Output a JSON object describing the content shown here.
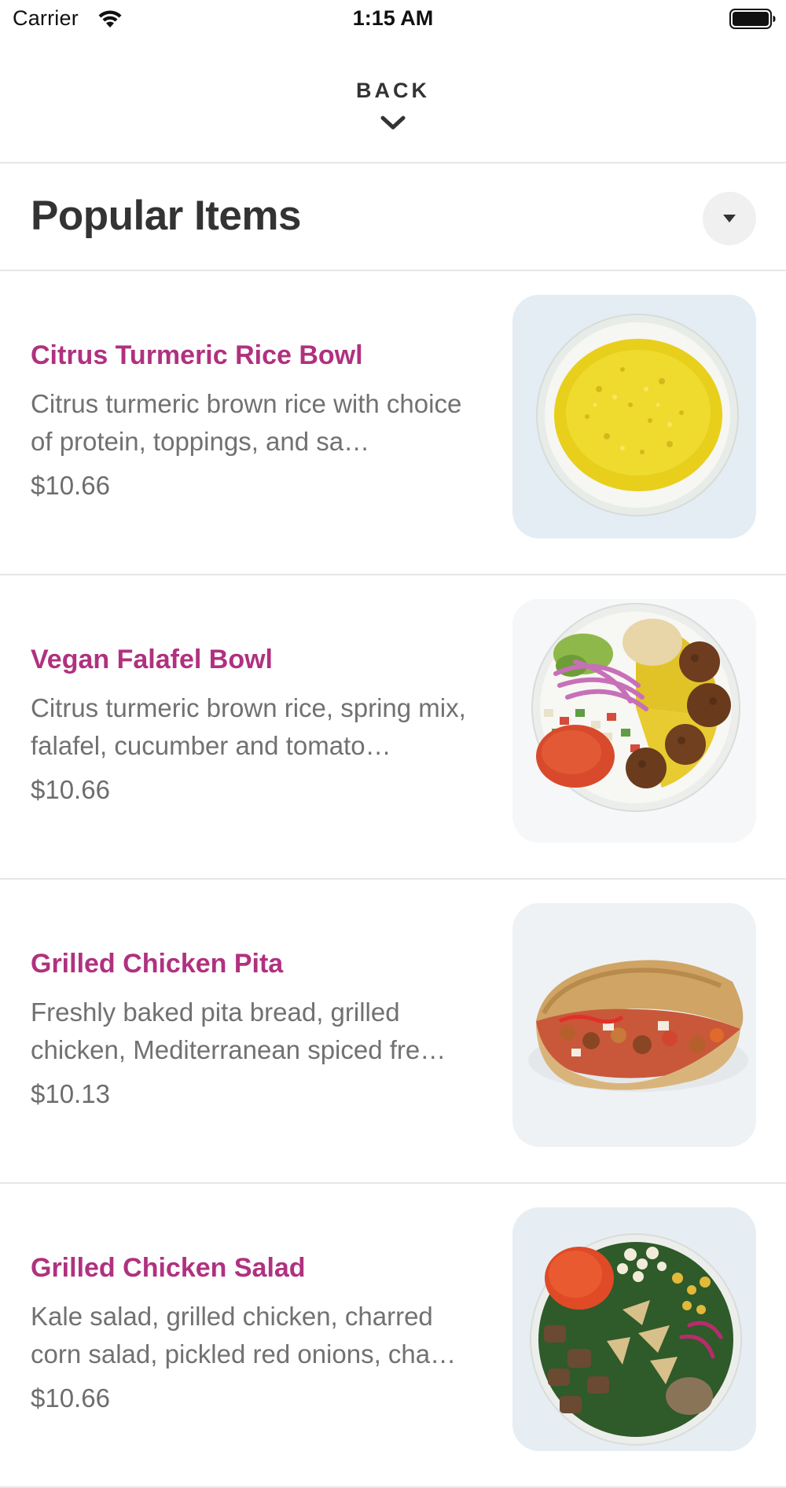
{
  "status_bar": {
    "carrier": "Carrier",
    "time": "1:15 AM",
    "wifi_icon": "wifi-icon",
    "battery_icon": "battery-icon"
  },
  "header": {
    "back_label": "BACK",
    "back_icon": "chevron-down-icon"
  },
  "section": {
    "title": "Popular Items",
    "toggle_icon": "caret-down-icon"
  },
  "colors": {
    "item_name": "#b0317f",
    "text_primary": "#333333",
    "text_secondary": "#717171",
    "divider": "#e6e6e6"
  },
  "items": [
    {
      "name": "Citrus Turmeric Rice Bowl",
      "description": "Citrus turmeric brown rice with choice of protein, toppings, and sa…",
      "price": "$10.66",
      "image": "rice-bowl-photo"
    },
    {
      "name": "Vegan Falafel Bowl",
      "description": "Citrus turmeric brown rice, spring mix, falafel, cucumber and tomato…",
      "price": "$10.66",
      "image": "falafel-bowl-photo"
    },
    {
      "name": "Grilled Chicken Pita",
      "description": "Freshly baked pita bread, grilled chicken, Mediterranean spiced fre…",
      "price": "$10.13",
      "image": "chicken-pita-photo"
    },
    {
      "name": "Grilled Chicken Salad",
      "description": "Kale salad, grilled chicken, charred corn salad, pickled red onions, cha…",
      "price": "$10.66",
      "image": "chicken-salad-photo"
    }
  ]
}
